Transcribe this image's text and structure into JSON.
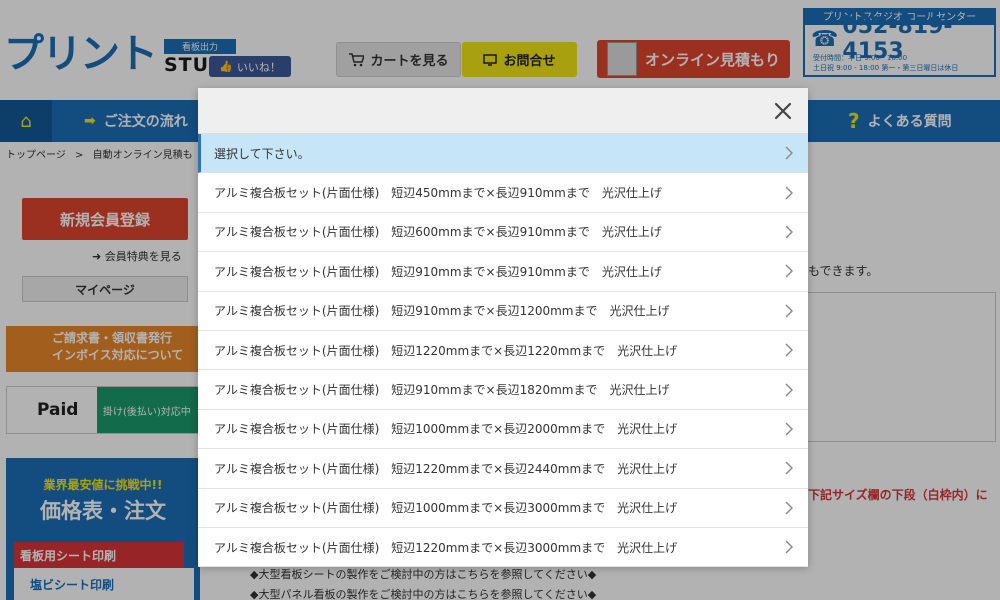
{
  "header": {
    "logo_text": "プリント",
    "logo_tag": "看板出力",
    "logo_studio": "STUDIO",
    "like_label": "いいね！",
    "cart_label": "カートを見る",
    "contact_label": "お問合せ",
    "estimate_label": "オンライン見積もり",
    "callcenter": {
      "title": "プリントスタジオ コールセンター",
      "phone": "052-819-4153",
      "hours_line1": "受付時間：平日 9:00 - 18:00",
      "hours_line2": "土日祝 9:00 - 18:00 第一・第三日曜日は休日"
    }
  },
  "nav": {
    "order_label": "ご注文の流れ",
    "faq_label": "よくある質問"
  },
  "breadcrumb": {
    "home": "トップページ",
    "separator": ">",
    "current": "自動オンライン見積も"
  },
  "sidebar": {
    "register_label": "新規会員登録",
    "benefit_label": "会員特典を見る",
    "mypage_label": "マイページ",
    "invoice_line1": "ご請求書・領収書発行",
    "invoice_line2": "インボイス対応について",
    "paid_logo": "Paid",
    "paid_tag": "掛け(後払い)対応中",
    "price_sub": "業界最安値に挑戦中!!",
    "price_main": "価格表・注文",
    "sheet_tab": "看板用シート印刷",
    "sheet_item": "塩ビシート印刷"
  },
  "main": {
    "line1": "もできます。",
    "red_note": "下記サイズ欄の下段（白枠内）に",
    "footnote1": "◆大型看板シートの製作をご検討中の方はこちらを参照してください◆",
    "footnote2": "◆大型パネル看板の製作をご検討中の方はこちらを参照してください◆"
  },
  "modal": {
    "close_label": "×",
    "selected_index": 0,
    "options": [
      "選択して下さい。",
      "アルミ複合板セット(片面仕様)　短辺450mmまで×長辺910mmまで　光沢仕上げ",
      "アルミ複合板セット(片面仕様)　短辺600mmまで×長辺910mmまで　光沢仕上げ",
      "アルミ複合板セット(片面仕様)　短辺910mmまで×長辺910mmまで　光沢仕上げ",
      "アルミ複合板セット(片面仕様)　短辺910mmまで×長辺1200mmまで　光沢仕上げ",
      "アルミ複合板セット(片面仕様)　短辺1220mmまで×長辺1220mmまで　光沢仕上げ",
      "アルミ複合板セット(片面仕様)　短辺910mmまで×長辺1820mmまで　光沢仕上げ",
      "アルミ複合板セット(片面仕様)　短辺1000mmまで×長辺2000mmまで　光沢仕上げ",
      "アルミ複合板セット(片面仕様)　短辺1220mmまで×長辺2440mmまで　光沢仕上げ",
      "アルミ複合板セット(片面仕様)　短辺1000mmまで×長辺3000mmまで　光沢仕上げ",
      "アルミ複合板セット(片面仕様)　短辺1220mmまで×長辺3000mmまで　光沢仕上げ"
    ]
  },
  "colors": {
    "brand_blue": "#1c6fb8",
    "accent_red": "#e0462f",
    "accent_yellow": "#f2e616",
    "selected_bg": "#c6e6f8"
  }
}
